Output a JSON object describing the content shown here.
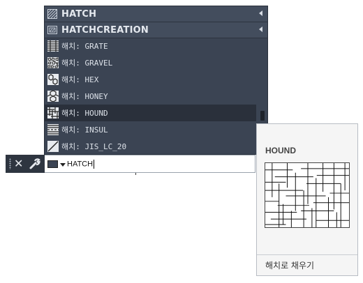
{
  "dropdown": {
    "commands": [
      {
        "label": "HATCH",
        "icon": "hatch-icon"
      },
      {
        "label": "HATCHCREATION",
        "icon": "hatchcreation-icon"
      }
    ],
    "items": [
      {
        "text": "해치: GRATE",
        "icon": "grate-pattern-icon"
      },
      {
        "text": "해치: GRAVEL",
        "icon": "gravel-pattern-icon"
      },
      {
        "text": "해치: HEX",
        "icon": "hex-pattern-icon"
      },
      {
        "text": "해치: HONEY",
        "icon": "honey-pattern-icon"
      },
      {
        "text": "해치: HOUND",
        "icon": "hound-pattern-icon",
        "selected": true
      },
      {
        "text": "해치: INSUL",
        "icon": "insul-pattern-icon"
      },
      {
        "text": "해치: JIS_LC_20",
        "icon": "jis-lc-20-pattern-icon"
      }
    ]
  },
  "command_line": {
    "input_value": "HATCH"
  },
  "preview": {
    "title": "HOUND",
    "description": "해치로 채우기"
  },
  "colors": {
    "dropdown_bg": "#3b4453",
    "selected_bg": "#2a303b",
    "toolbar_bg": "#2e3540"
  }
}
